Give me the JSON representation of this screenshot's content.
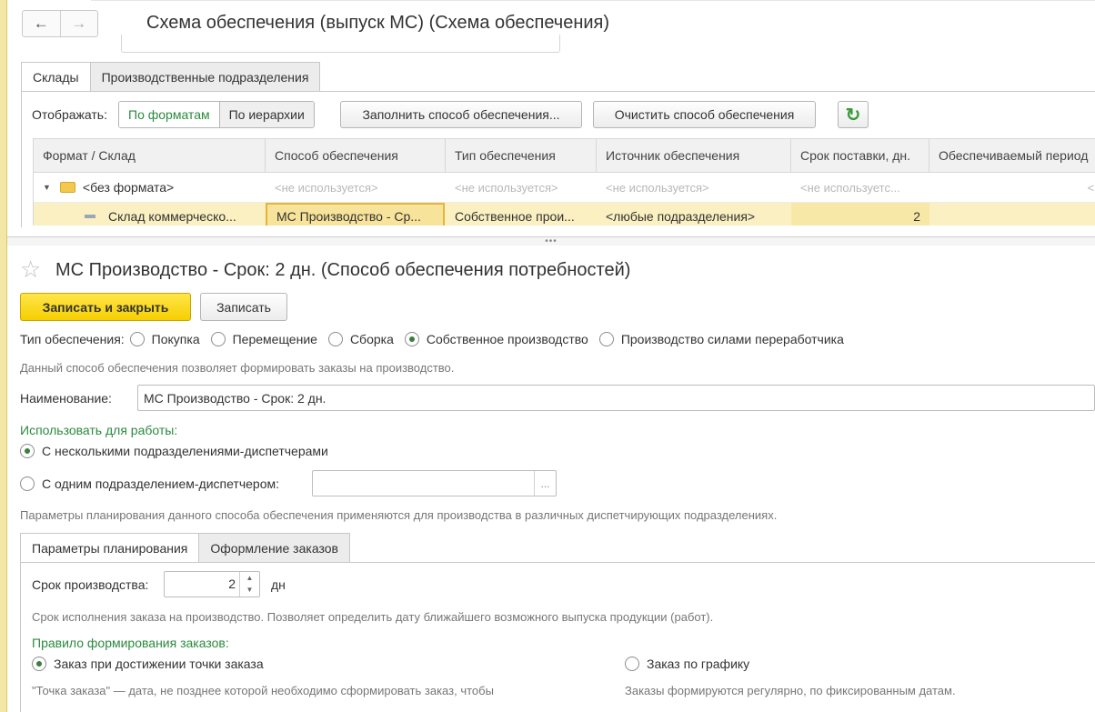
{
  "window": {
    "title": "Схема обеспечения (выпуск МС) (Схема обеспечения)",
    "nav_back": "←",
    "nav_forward": "→"
  },
  "top_tabs": [
    "Склады",
    "Производственные подразделения"
  ],
  "toolbar": {
    "show_label": "Отображать:",
    "by_formats": "По форматам",
    "by_hierarchy": "По иерархии",
    "fill_button": "Заполнить способ обеспечения...",
    "clear_button": "Очистить способ обеспечения",
    "refresh_icon": "↻"
  },
  "grid": {
    "columns": [
      "Формат / Склад",
      "Способ обеспечения",
      "Тип обеспечения",
      "Источник обеспечения",
      "Срок поставки, дн.",
      "Обеспечиваемый период"
    ],
    "group_row": {
      "name": "<без формата>",
      "c1": "<не используется>",
      "c2": "<не используется>",
      "c3": "<не используется>",
      "c4": "<не используетс...",
      "c5": "<не ис"
    },
    "row": {
      "name": "Склад коммерческо...",
      "method": "МС Производство - Ср...",
      "type": "Собственное прои...",
      "source": "<любые подразделения>",
      "days": "2",
      "period": ""
    }
  },
  "splitter_grip": "•••",
  "form": {
    "title": "МС Производство - Срок: 2 дн. (Способ обеспечения потребностей)",
    "save_close": "Записать и закрыть",
    "save": "Записать",
    "type_label": "Тип обеспечения:",
    "types": [
      {
        "label": "Покупка",
        "selected": false
      },
      {
        "label": "Перемещение",
        "selected": false
      },
      {
        "label": "Сборка",
        "selected": false
      },
      {
        "label": "Собственное производство",
        "selected": true
      },
      {
        "label": "Производство силами переработчика",
        "selected": false
      }
    ],
    "type_hint": "Данный способ обеспечения позволяет формировать заказы на производство.",
    "name_label": "Наименование:",
    "name_value": "МС Производство - Срок: 2 дн.",
    "use_for_label": "Использовать для работы:",
    "use_multi": "С несколькими подразделениями-диспетчерами",
    "use_single": "С одним подразделением-диспетчером:",
    "dispatcher_value": "",
    "ellipsis": "...",
    "params_hint": "Параметры планирования данного способа обеспечения применяются для производства в различных диспетчирующих подразделениях.",
    "tabs": [
      "Параметры планирования",
      "Оформление заказов"
    ],
    "term_label": "Срок производства:",
    "term_value": "2",
    "term_unit": "дн",
    "term_hint": "Срок исполнения заказа на производство. Позволяет определить дату ближайшего возможного выпуска продукции (работ).",
    "rule_label": "Правило формирования заказов:",
    "rule_point": "Заказ при достижении точки заказа",
    "rule_schedule": "Заказ по графику",
    "rule_point_hint": "\"Точка заказа\" — дата, не позднее которой необходимо сформировать заказ, чтобы",
    "rule_schedule_hint": "Заказы формируются регулярно, по фиксированным датам."
  }
}
